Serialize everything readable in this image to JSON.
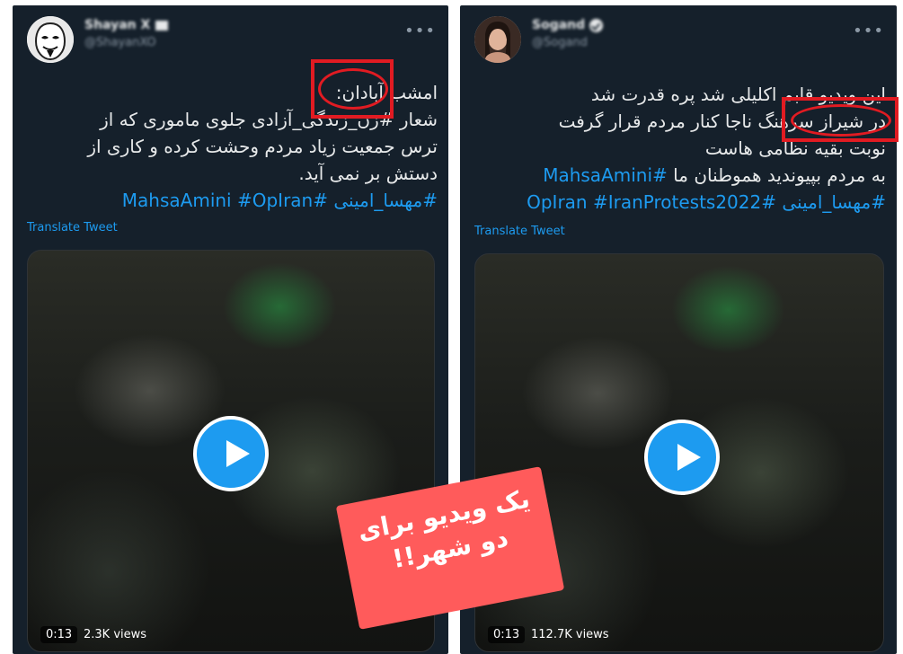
{
  "left_tweet": {
    "display_name": "Shayan X",
    "handle": "@ShayanXO",
    "text_lines": [
      "امشب آبادان:",
      "شعار #زن_زندگی_آزادی جلوی ماموری که از",
      "ترس جمعیت زیاد مردم وحشت کرده و کاری از",
      "دستش بر نمی آید."
    ],
    "hashtags_line": [
      "#مهسا_امینی",
      "#MahsaAmini",
      "#OpIran"
    ],
    "translate_label": "Translate Tweet",
    "video_time": "0:13",
    "video_views": "2.3K views",
    "highlighted_word": "آبادان"
  },
  "right_tweet": {
    "display_name": "Sogand",
    "handle": "@Sogand",
    "text_lines": [
      "این ویدیو قابم اکلیلی شد پره قدرت شد",
      "در شیراز سرهنگ ناجا کنار مردم قرار گرفت",
      "نوبت بقیه نظامی هاست",
      "به مردم بپیوندید هموطنان ما"
    ],
    "hashtags_line_1": [
      "#MahsaAmini"
    ],
    "hashtags_line_2": [
      "#IranProtests2022",
      "#OpIran",
      "#مهسا_امینی"
    ],
    "translate_label": "Translate Tweet",
    "video_time": "0:13",
    "video_views": "112.7K views",
    "highlighted_word": "در شیراز"
  },
  "overlay_caption": [
    "یک ویدیو برای",
    "دو شهر!!"
  ],
  "icons": {
    "more": "more-dots-icon",
    "play": "play-icon",
    "verified": "verified-badge-icon",
    "flag": "flag-icon"
  },
  "colors": {
    "panel_bg": "#15202b",
    "hashtag": "#1d9bf0",
    "highlight_box": "#e11b22",
    "caption_bg": "#ff5b5b"
  }
}
